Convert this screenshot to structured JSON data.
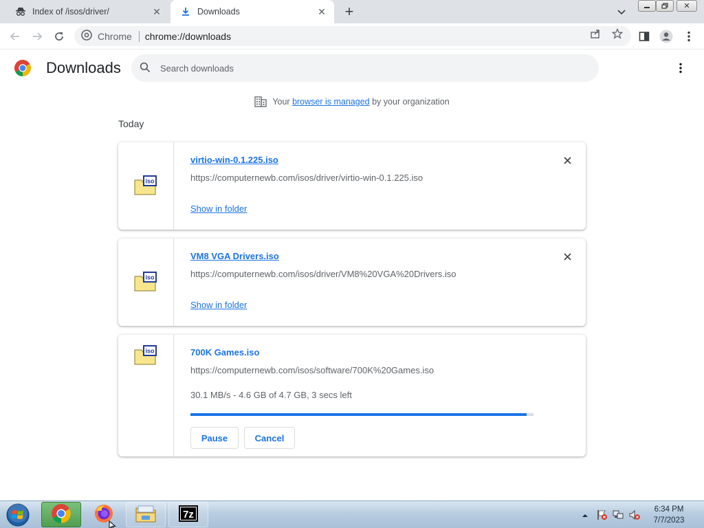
{
  "tabs": [
    {
      "title": "Index of /isos/driver/",
      "icon": "incognito-icon"
    },
    {
      "title": "Downloads",
      "icon": "download-icon",
      "active": true
    }
  ],
  "toolbar": {
    "site_name": "Chrome",
    "url": "chrome://downloads"
  },
  "downloads_page": {
    "title": "Downloads",
    "search_placeholder": "Search downloads",
    "managed_prefix": "Your",
    "managed_link": "browser is managed",
    "managed_suffix": "by your organization",
    "section_today": "Today",
    "items": [
      {
        "name": "virtio-win-0.1.225.iso",
        "url": "https://computernewb.com/isos/driver/virtio-win-0.1.225.iso",
        "action": "Show in folder",
        "state": "complete"
      },
      {
        "name": "VM8 VGA Drivers.iso",
        "url": "https://computernewb.com/isos/driver/VM8%20VGA%20Drivers.iso",
        "action": "Show in folder",
        "state": "complete"
      },
      {
        "name": "700K Games.iso",
        "url": "https://computernewb.com/isos/software/700K%20Games.iso",
        "status": "30.1 MB/s - 4.6 GB of 4.7 GB, 3 secs left",
        "progress_fraction": 0.98,
        "pause_label": "Pause",
        "cancel_label": "Cancel",
        "state": "in_progress"
      }
    ]
  },
  "taskbar": {
    "apps": [
      "chrome-icon",
      "firefox-icon",
      "file-explorer-icon",
      "7zip-icon"
    ],
    "time": "6:34 PM",
    "date": "7/7/2023"
  },
  "colors": {
    "accent": "#1a73e8",
    "tabstrip": "#dee1e6",
    "omnibox": "#f1f3f4"
  }
}
